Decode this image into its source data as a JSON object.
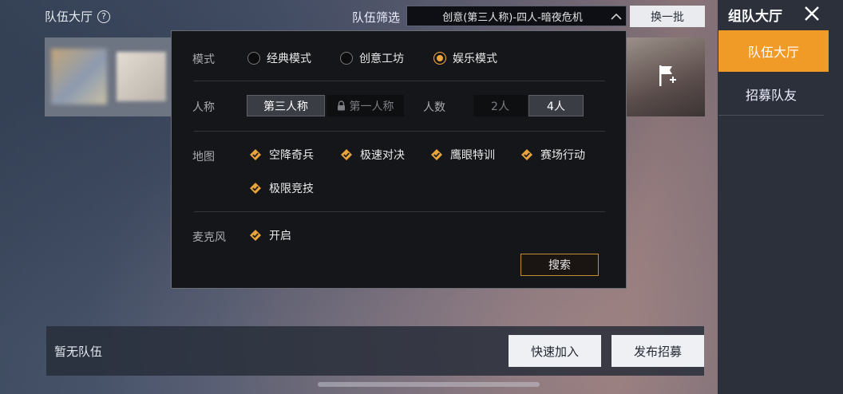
{
  "header": {
    "lobby_title": "队伍大厅",
    "filter_label": "队伍筛选",
    "filter_value": "创意(第三人称)-四人-暗夜危机",
    "refresh_label": "换一批"
  },
  "side_panel": {
    "title": "组队大厅",
    "tabs": [
      {
        "label": "队伍大厅",
        "active": true
      },
      {
        "label": "招募队友",
        "active": false
      }
    ]
  },
  "filter_dialog": {
    "mode": {
      "label": "模式",
      "options": [
        {
          "label": "经典模式",
          "selected": false
        },
        {
          "label": "创意工坊",
          "selected": false
        },
        {
          "label": "娱乐模式",
          "selected": true
        }
      ]
    },
    "perspective": {
      "label": "人称",
      "options": [
        {
          "label": "第三人称",
          "selected": true
        },
        {
          "label": "第一人称",
          "selected": false,
          "locked": true
        }
      ]
    },
    "players": {
      "label": "人数",
      "options": [
        {
          "label": "2人",
          "selected": false
        },
        {
          "label": "4人",
          "selected": true
        }
      ]
    },
    "map": {
      "label": "地图",
      "options": [
        {
          "label": "空降奇兵",
          "checked": true
        },
        {
          "label": "极速对决",
          "checked": true
        },
        {
          "label": "鹰眼特训",
          "checked": true
        },
        {
          "label": "赛场行动",
          "checked": true
        },
        {
          "label": "极限竞技",
          "checked": true
        }
      ]
    },
    "mic": {
      "label": "麦克风",
      "option": {
        "label": "开启",
        "checked": true
      }
    },
    "search_label": "搜索"
  },
  "bottom": {
    "empty_text": "暂无队伍",
    "quick_join_label": "快速加入",
    "recruit_label": "发布招募"
  },
  "colors": {
    "accent": "#f09a28",
    "panel": "#2b303b",
    "dialog_bg": "#151619"
  }
}
